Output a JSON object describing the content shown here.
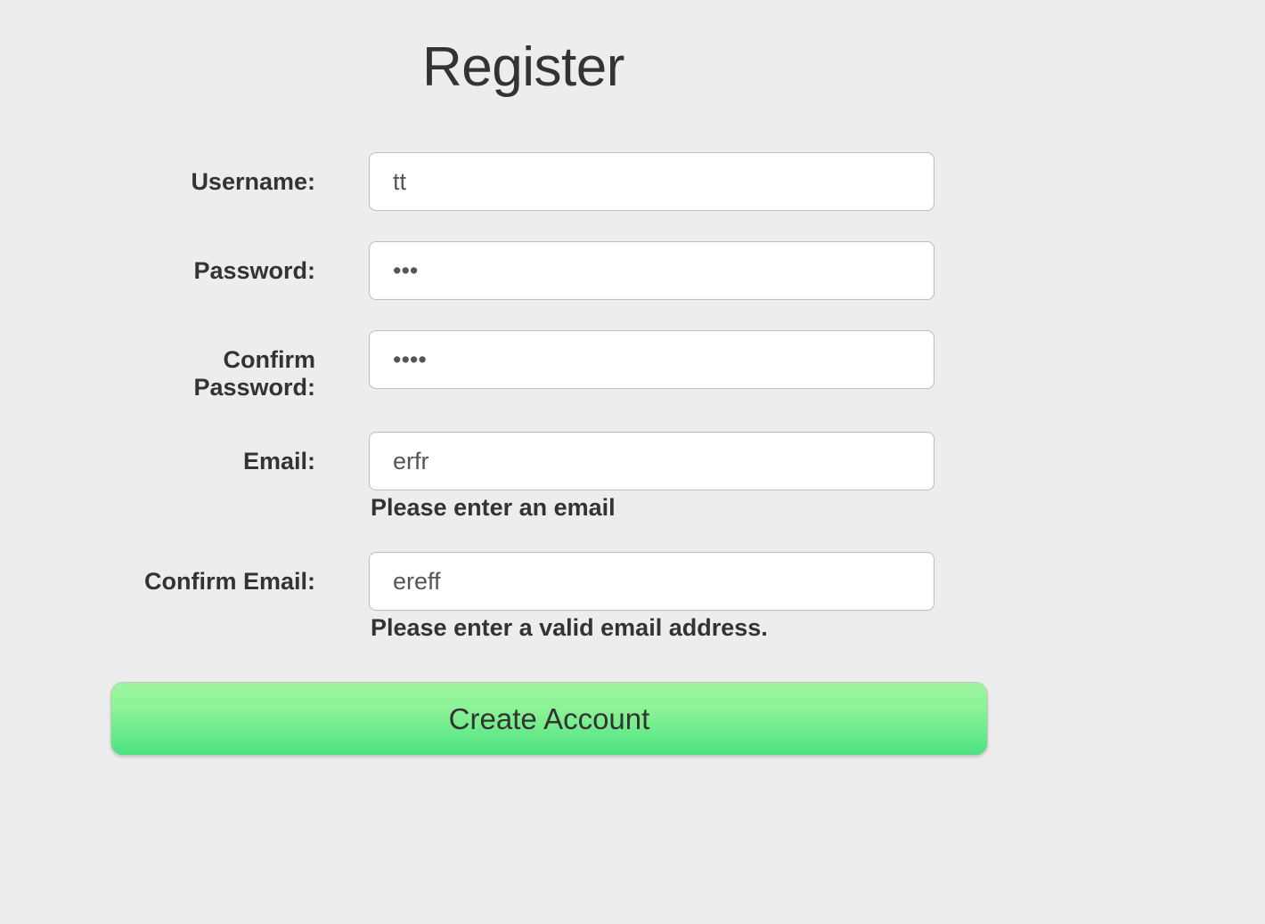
{
  "title": "Register",
  "fields": {
    "username": {
      "label": "Username:",
      "value": "tt",
      "error": ""
    },
    "password": {
      "label": "Password:",
      "value": "•••",
      "error": ""
    },
    "confirm_password": {
      "label": "Confirm Password:",
      "value": "••••",
      "error": ""
    },
    "email": {
      "label": "Email:",
      "value": "erfr",
      "error": "Please enter an email"
    },
    "confirm_email": {
      "label": "Confirm Email:",
      "value": "ereff",
      "error": "Please enter a valid email address."
    }
  },
  "submit_label": "Create Account"
}
